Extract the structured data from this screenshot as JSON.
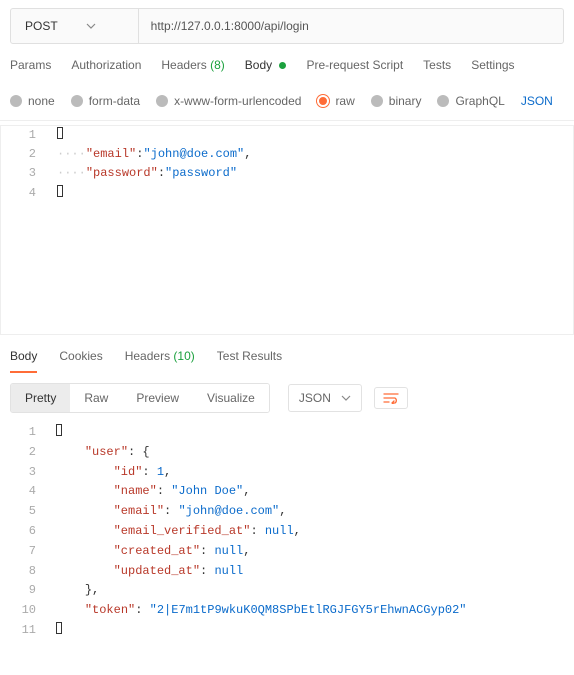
{
  "request": {
    "method": "POST",
    "url": "http://127.0.0.1:8000/api/login"
  },
  "tabs": {
    "params": "Params",
    "authorization": "Authorization",
    "headers_label": "Headers",
    "headers_count": "(8)",
    "body": "Body",
    "prerequest": "Pre-request Script",
    "tests": "Tests",
    "settings": "Settings"
  },
  "body_types": {
    "none": "none",
    "formdata": "form-data",
    "xwww": "x-www-form-urlencoded",
    "raw": "raw",
    "binary": "binary",
    "graphql": "GraphQL",
    "json": "JSON"
  },
  "request_body": {
    "email_key": "\"email\"",
    "email_val": "\"john@doe.com\"",
    "password_key": "\"password\"",
    "password_val": "\"password\""
  },
  "response_tabs": {
    "body": "Body",
    "cookies": "Cookies",
    "headers_label": "Headers",
    "headers_count": "(10)",
    "testresults": "Test Results"
  },
  "view": {
    "pretty": "Pretty",
    "raw": "Raw",
    "preview": "Preview",
    "visualize": "Visualize",
    "json": "JSON"
  },
  "response_body": {
    "user_key": "\"user\"",
    "id_key": "\"id\"",
    "id_val": "1",
    "name_key": "\"name\"",
    "name_val": "\"John Doe\"",
    "email_key": "\"email\"",
    "email_val": "\"john@doe.com\"",
    "email_verified_key": "\"email_verified_at\"",
    "created_key": "\"created_at\"",
    "updated_key": "\"updated_at\"",
    "null_val": "null",
    "token_key": "\"token\"",
    "token_val": "\"2|E7m1tP9wkuK0QM8SPbEtlRGJFGY5rEhwnACGyp02\""
  },
  "line_numbers": {
    "l1": "1",
    "l2": "2",
    "l3": "3",
    "l4": "4",
    "l5": "5",
    "l6": "6",
    "l7": "7",
    "l8": "8",
    "l9": "9",
    "l10": "10",
    "l11": "11"
  }
}
